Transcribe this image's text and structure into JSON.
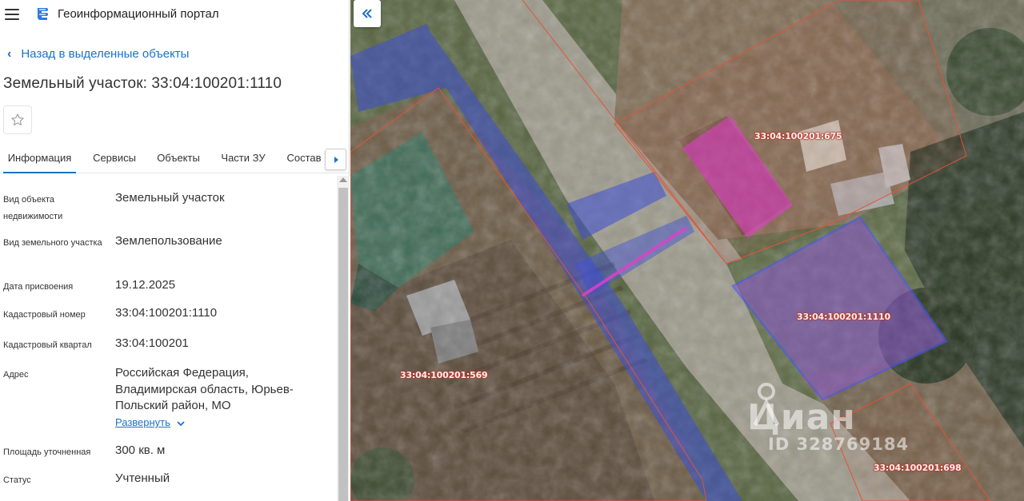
{
  "header": {
    "menu_icon": "hamburger-menu-icon",
    "logo_icon": "portal-logo-icon",
    "title": "Геоинформационный портал"
  },
  "nav": {
    "back_label": "Назад в выделенные объекты"
  },
  "object": {
    "title": "Земельный участок: 33:04:100201:1110"
  },
  "tabs": [
    {
      "label": "Информация",
      "active": true
    },
    {
      "label": "Сервисы",
      "active": false
    },
    {
      "label": "Объекты",
      "active": false
    },
    {
      "label": "Части ЗУ",
      "active": false
    },
    {
      "label": "Состав",
      "active": false
    }
  ],
  "properties": [
    {
      "label": "Вид объекта недвижимости",
      "value": "Земельный участок"
    },
    {
      "label": "Вид земельного участка",
      "value": "Землепользование"
    },
    {
      "label": "Дата присвоения",
      "value": "19.12.2025"
    },
    {
      "label": "Кадастровый номер",
      "value": "33:04:100201:1110"
    },
    {
      "label": "Кадастровый квартал",
      "value": "33:04:100201"
    },
    {
      "label": "Адрес",
      "value": "Российская Федерация, Владимирская область, Юрьев-Польский район, МО"
    },
    {
      "label": "Площадь уточненная",
      "value": "300 кв. м"
    },
    {
      "label": "Статус",
      "value": "Учтенный"
    }
  ],
  "expand_label": "Развернуть",
  "map": {
    "parcel_labels": [
      "33:04:100201:675",
      "33:04:100201:1110",
      "33:04:100201:569",
      "33:04:100201:698"
    ],
    "watermark_brand": "Циан",
    "watermark_id": "ID 328769184"
  },
  "colors": {
    "accent": "#1a73c9",
    "parcel_border": "#e2533a",
    "selected_fill": "#8a5bc9",
    "selected_border": "#4a56ff",
    "road_overlay": "#3d4fd6",
    "building_fill": "#e040c8"
  }
}
